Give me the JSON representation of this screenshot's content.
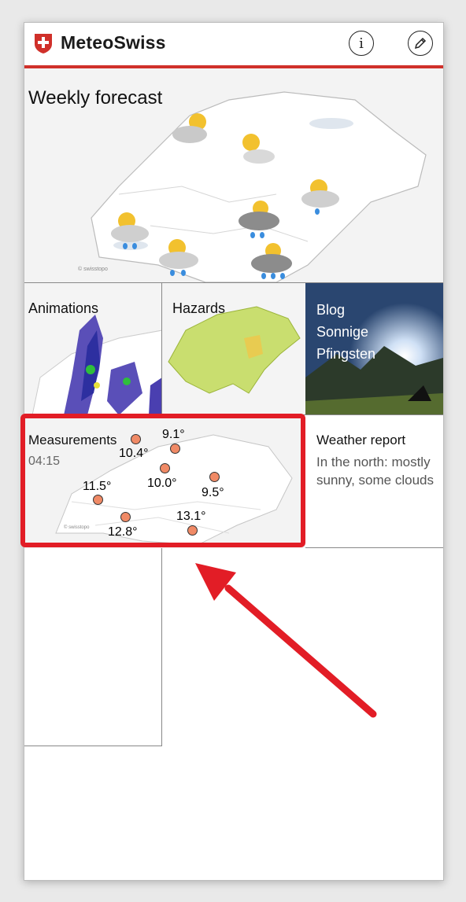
{
  "header": {
    "title": "MeteoSwiss",
    "info_icon": "info-icon",
    "edit_icon": "pencil-icon"
  },
  "weekly_forecast": {
    "label": "Weekly forecast",
    "credit": "© swisstopo"
  },
  "animations": {
    "label": "Animations"
  },
  "hazards": {
    "label": "Hazards"
  },
  "blog": {
    "line1": "Blog",
    "line2": "Sonnige",
    "line3": "Pfingsten"
  },
  "measurements": {
    "label": "Measurements",
    "time": "04:15",
    "credit": "© swisstopo",
    "values": [
      "9.1°",
      "10.4°",
      "10.0°",
      "11.5°",
      "9.5°",
      "13.1°",
      "12.8°"
    ]
  },
  "weather_report": {
    "label": "Weather report",
    "text": "In the north: mostly sunny, some clouds"
  },
  "add_tile": {
    "icon": "plus-icon"
  },
  "colors": {
    "accent": "#d0302a",
    "highlight": "#e21d26"
  }
}
